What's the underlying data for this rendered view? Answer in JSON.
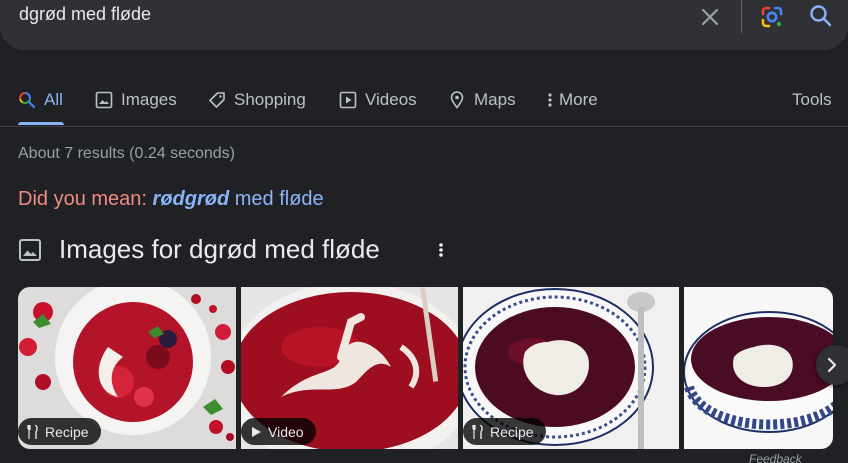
{
  "search": {
    "query": "dgrød med fløde",
    "clear_icon": "close-icon",
    "lens_icon": "google-lens-icon",
    "search_icon": "search-icon"
  },
  "tabs": [
    {
      "label": "All",
      "icon": "search-multicolor-icon",
      "active": true
    },
    {
      "label": "Images",
      "icon": "image-icon"
    },
    {
      "label": "Shopping",
      "icon": "tag-icon"
    },
    {
      "label": "Videos",
      "icon": "play-box-icon"
    },
    {
      "label": "Maps",
      "icon": "map-pin-icon"
    },
    {
      "label": "More",
      "icon": "more-vert-icon"
    }
  ],
  "tools_label": "Tools",
  "result_stats": "About 7 results (0.24 seconds)",
  "did_you_mean": {
    "label": "Did you mean:",
    "bold": "rødgrød",
    "rest": "med fløde"
  },
  "images_section": {
    "title": "Images for dgrød med fløde",
    "items": [
      {
        "badge": "Recipe",
        "badge_icon": "fork-knife-icon"
      },
      {
        "badge": "Video",
        "badge_icon": "play-icon"
      },
      {
        "badge": "Recipe",
        "badge_icon": "fork-knife-icon"
      },
      {
        "badge": "",
        "badge_icon": ""
      }
    ]
  },
  "feedback_label": "Feedback",
  "colors": {
    "background": "#202124",
    "search_bar": "#303134",
    "link": "#8ab4f8",
    "did_you_mean": "#f28b82",
    "muted": "#9aa0a6"
  }
}
